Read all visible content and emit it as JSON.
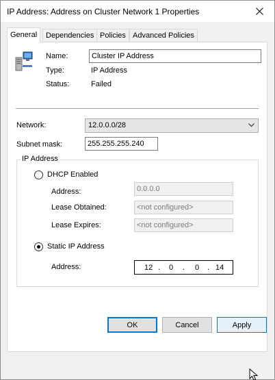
{
  "window": {
    "title": "IP Address: Address on Cluster Network 1 Properties"
  },
  "tabs": [
    {
      "label": "General",
      "active": true
    },
    {
      "label": "Dependencies"
    },
    {
      "label": "Policies"
    },
    {
      "label": "Advanced Policies"
    }
  ],
  "resource": {
    "name_label": "Name:",
    "name_value": "Cluster IP Address",
    "type_label": "Type:",
    "type_value": "IP Address",
    "status_label": "Status:",
    "status_value": "Failed"
  },
  "network": {
    "network_label": "Network:",
    "network_value": "12.0.0.0/28",
    "subnet_label": "Subnet mask:",
    "subnet_value": "255.255.255.240"
  },
  "ip_group": {
    "title": "IP Address",
    "dhcp_label": "DHCP Enabled",
    "dhcp_selected": false,
    "dhcp_address_label": "Address:",
    "dhcp_address_value": "0.0.0.0",
    "lease_obtained_label": "Lease Obtained:",
    "lease_obtained_value": "<not configured>",
    "lease_expires_label": "Lease Expires:",
    "lease_expires_value": "<not configured>",
    "static_label": "Static IP Address",
    "static_selected": true,
    "static_address_label": "Address:",
    "static_octets": [
      "12",
      "0",
      "0",
      "14"
    ],
    "octet_separator": "."
  },
  "buttons": {
    "ok": "OK",
    "cancel": "Cancel",
    "apply": "Apply"
  }
}
